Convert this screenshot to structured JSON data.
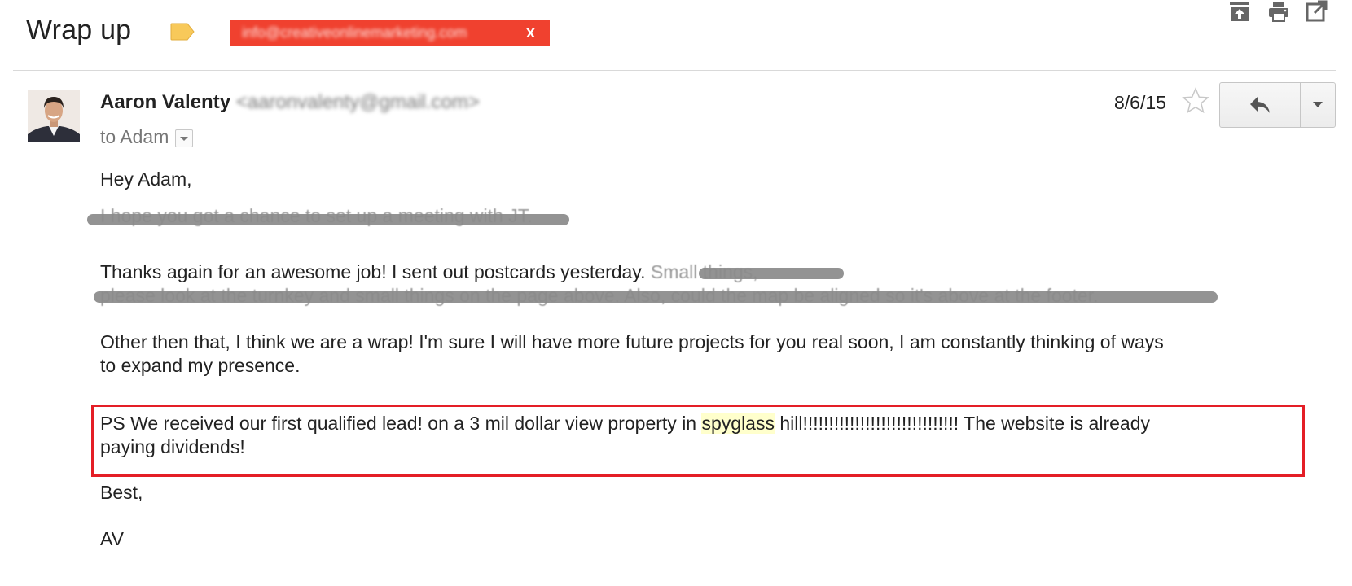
{
  "header": {
    "subject": "Wrap up",
    "label_text": "info@creativeonlinemarketing.com",
    "label_close": "x",
    "colors": {
      "label_bg": "#f0412f",
      "tag_color": "#f8c95a"
    }
  },
  "message": {
    "sender_name": "Aaron Valenty",
    "sender_email": "<aaronvalenty@gmail.com>",
    "to_text": "to Adam",
    "date": "8/6/15"
  },
  "body": {
    "greeting": "Hey Adam,",
    "line2_redacted": "I hope you got a chance to set up a meeting with JT.",
    "line3_visible": "Thanks again for an awesome job!  I sent out postcards yesterday.",
    "line3_redacted": " Small things,",
    "line4_redacted": "please look at the turnkey and small things on the page above. Also, could the map be aligned so it's above at the footer.",
    "para_other_1": "Other then that, I think we are a wrap!  I'm sure I will have more future projects for you real soon, I am constantly thinking of ways",
    "para_other_2": "to expand my presence.",
    "ps_before": "PS We received our first qualified lead! on a 3 mil dollar view property in ",
    "ps_highlight": "spyglass",
    "ps_after": " hill!!!!!!!!!!!!!!!!!!!!!!!!!!!!!!  The website is already",
    "ps_line2": "paying dividends!",
    "signoff": "Best,",
    "signature": "AV"
  }
}
